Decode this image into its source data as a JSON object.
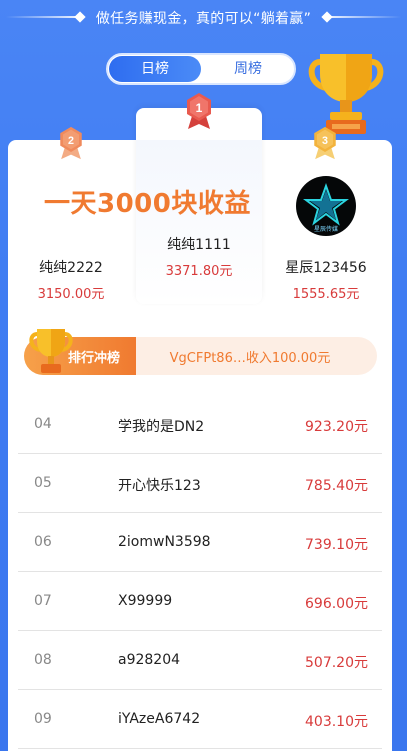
{
  "slogan": "做任务赚现金，真的可以“躺着赢”",
  "tabs": [
    {
      "label": "日榜",
      "active": true
    },
    {
      "label": "周榜",
      "active": false
    }
  ],
  "promo_text": "一天3000块收益",
  "podium": {
    "first": {
      "rank": "1",
      "name": "纯纯1111",
      "amount": "3371.80元"
    },
    "second": {
      "rank": "2",
      "name": "纯纯2222",
      "amount": "3150.00元"
    },
    "third": {
      "rank": "3",
      "name": "星辰123456",
      "amount": "1555.65元",
      "avatar_text": "星辰传媒"
    }
  },
  "banner": {
    "label": "排行冲榜",
    "message": "VgCFPt86…收入100.00元"
  },
  "list": [
    {
      "rank": "04",
      "name": "学我的是DN2",
      "amount": "923.20元"
    },
    {
      "rank": "05",
      "name": "开心快乐123",
      "amount": "785.40元"
    },
    {
      "rank": "06",
      "name": "2iomwN3598",
      "amount": "739.10元"
    },
    {
      "rank": "07",
      "name": "X99999",
      "amount": "696.00元"
    },
    {
      "rank": "08",
      "name": "a928204",
      "amount": "507.20元"
    },
    {
      "rank": "09",
      "name": "iYAzeA6742",
      "amount": "403.10元"
    }
  ],
  "colors": {
    "background": "#3f7cf2",
    "accent_orange": "#f07a30",
    "amount_red": "#d83b3b",
    "tab_active": "#2e6df0"
  }
}
